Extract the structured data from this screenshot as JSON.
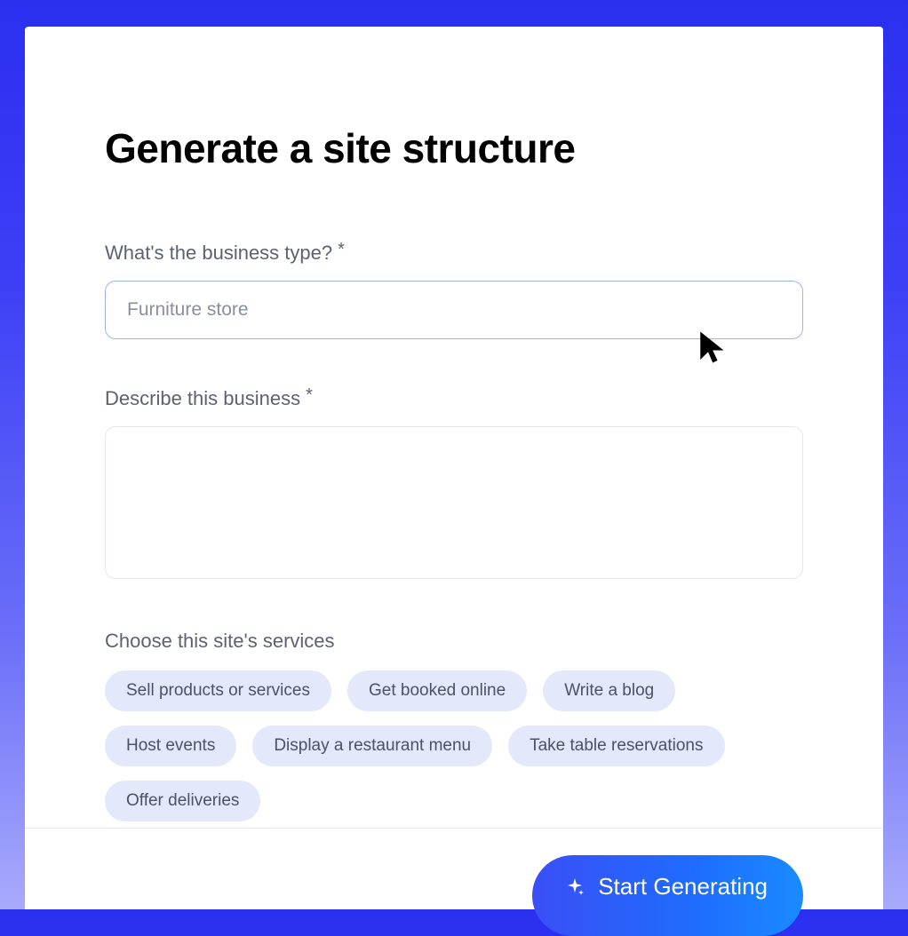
{
  "page": {
    "title": "Generate a site structure"
  },
  "form": {
    "business_type": {
      "label": "What's the business type?",
      "required_mark": "*",
      "value": "Furniture store"
    },
    "describe": {
      "label": "Describe this business",
      "required_mark": "*",
      "value": ""
    },
    "services": {
      "label": "Choose this site's services",
      "options": [
        "Sell products or services",
        "Get booked online",
        "Write a blog",
        "Host events",
        "Display a restaurant menu",
        "Take table reservations",
        "Offer deliveries"
      ]
    }
  },
  "actions": {
    "generate": "Start Generating"
  }
}
